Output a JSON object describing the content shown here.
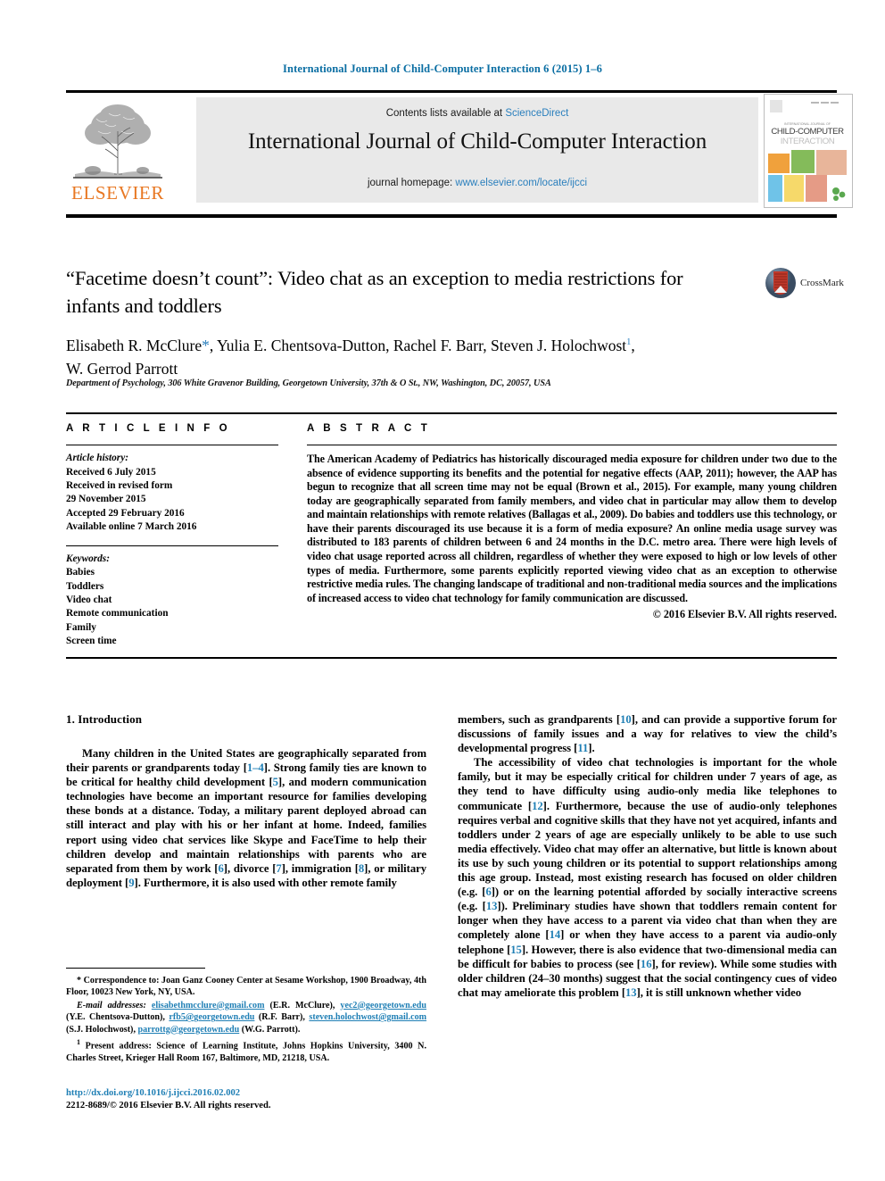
{
  "running_head": "International Journal of Child-Computer Interaction 6 (2015) 1–6",
  "masthead": {
    "publisher_name": "ELSEVIER",
    "contents_prefix": "Contents lists available at ",
    "contents_link": "ScienceDirect",
    "journal_title": "International Journal of Child-Computer Interaction",
    "homepage_prefix": "journal homepage: ",
    "homepage_link": "www.elsevier.com/locate/ijcci",
    "cover_caption_small": "INTERNATIONAL JOURNAL OF",
    "cover_caption_line1": "CHILD-COMPUTER",
    "cover_caption_line2": "INTERACTION"
  },
  "article": {
    "title": "“Facetime doesn’t count”: Video chat as an exception to media restrictions for infants and toddlers",
    "authors_line1_a": "Elisabeth R. McClure",
    "authors_star": "*",
    "authors_line1_b": ", Yulia E. Chentsova-Dutton, Rachel F. Barr, Steven J. Holochwost",
    "authors_sup": "1",
    "authors_line1_c": ",",
    "authors_line2": "W. Gerrod Parrott",
    "affiliation": "Department of Psychology, 306 White Gravenor Building, Georgetown University, 37th & O St., NW, Washington, DC, 20057, USA",
    "crossmark_label": "CrossMark"
  },
  "info": {
    "heading": "A R T I C L E    I N F O",
    "history_label": "Article history:",
    "history": [
      "Received 6 July 2015",
      "Received in revised form",
      "29 November 2015",
      "Accepted 29 February 2016",
      "Available online 7 March 2016"
    ],
    "keywords_label": "Keywords:",
    "keywords": [
      "Babies",
      "Toddlers",
      "Video chat",
      "Remote communication",
      "Family",
      "Screen time"
    ]
  },
  "abstract": {
    "heading": "A B S T R A C T",
    "text": "The American Academy of Pediatrics has historically discouraged media exposure for children under two due to the absence of evidence supporting its benefits and the potential for negative effects (AAP, 2011); however, the AAP has begun to recognize that all screen time may not be equal (Brown et al., 2015). For example, many young children today are geographically separated from family members, and video chat in particular may allow them to develop and maintain relationships with remote relatives (Ballagas et al., 2009). Do babies and toddlers use this technology, or have their parents discouraged its use because it is a form of media exposure? An online media usage survey was distributed to 183 parents of children between 6 and 24 months in the D.C. metro area. There were high levels of video chat usage reported across all children, regardless of whether they were exposed to high or low levels of other types of media. Furthermore, some parents explicitly reported viewing video chat as an exception to otherwise restrictive media rules. The changing landscape of traditional and non-traditional media sources and the implications of increased access to video chat technology for family communication are discussed.",
    "copyright": "© 2016 Elsevier B.V. All rights reserved."
  },
  "body": {
    "section_heading": "1. Introduction",
    "left_paragraph_1_parts": {
      "p1": "Many children in the United States are geographically separated from their parents or grandparents today [",
      "r1": "1–4",
      "p2": "]. Strong family ties are known to be critical for healthy child development [",
      "r2": "5",
      "p3": "], and modern communication technologies have become an important resource for families developing these bonds at a distance. Today, a military parent deployed abroad can still interact and play with his or her infant at home. Indeed, families report using video chat services like Skype and FaceTime to help their children develop and maintain relationships with parents who are separated from them by work [",
      "r3": "6",
      "p4": "], divorce [",
      "r4": "7",
      "p5": "], immigration [",
      "r5": "8",
      "p6": "], or military deployment [",
      "r6": "9",
      "p7": "]. Furthermore, it is also used with other remote family"
    },
    "right_paragraph_1_parts": {
      "p1": "members, such as grandparents [",
      "r1": "10",
      "p2": "], and can provide a supportive forum for discussions of family issues and a way for relatives to view the child’s developmental progress [",
      "r2": "11",
      "p3": "]."
    },
    "right_paragraph_2_parts": {
      "p1": "The accessibility of video chat technologies is important for the whole family, but it may be especially critical for children under 7 years of age, as they tend to have difficulty using audio-only media like telephones to communicate [",
      "r1": "12",
      "p2": "]. Furthermore, because the use of audio-only telephones requires verbal and cognitive skills that they have not yet acquired, infants and toddlers under 2 years of age are especially unlikely to be able to use such media effectively. Video chat may offer an alternative, but little is known about its use by such young children or its potential to support relationships among this age group. Instead, most existing research has focused on older children (e.g. [",
      "r2": "6",
      "p3": "]) or on the learning potential afforded by socially interactive screens (e.g. [",
      "r3": "13",
      "p4": "]). Preliminary studies have shown that toddlers remain content for longer when they have access to a parent via video chat than when they are completely alone [",
      "r4": "14",
      "p5": "] or when they have access to a parent via audio-only telephone [",
      "r5": "15",
      "p6": "]. However, there is also evidence that two-dimensional media can be difficult for babies to process (see [",
      "r6": "16",
      "p7": "], for review). While some studies with older children (24–30 months) suggest that the social contingency cues of video chat may ameliorate this problem [",
      "r7": "13",
      "p8": "], it is still unknown whether video"
    }
  },
  "footnotes": {
    "correspondence": {
      "marker": "*",
      "text": " Correspondence to: Joan Ganz Cooney Center at Sesame Workshop, 1900 Broadway, 4th Floor, 10023 New York, NY, USA."
    },
    "emails": {
      "label": "E-mail addresses:",
      "items": [
        {
          "email": "elisabethmcclure@gmail.com",
          "person": "(E.R. McClure)"
        },
        {
          "email": "yec2@georgetown.edu",
          "person": "(Y.E. Chentsova-Dutton)"
        },
        {
          "email": "rfb5@georgetown.edu",
          "person": "(R.F. Barr)"
        },
        {
          "email": "steven.holochwost@gmail.com",
          "person": "(S.J. Holochwost)"
        },
        {
          "email": "parrottg@georgetown.edu",
          "person": "(W.G. Parrott)"
        }
      ]
    },
    "present_address": {
      "marker": "1",
      "text": " Present address: Science of Learning Institute, Johns Hopkins University, 3400 N. Charles Street, Krieger Hall Room 167, Baltimore, MD, 21218, USA."
    }
  },
  "doi_block": {
    "doi": "http://dx.doi.org/10.1016/j.ijcci.2016.02.002",
    "issn": "2212-8689/© 2016 Elsevier B.V. All rights reserved."
  }
}
